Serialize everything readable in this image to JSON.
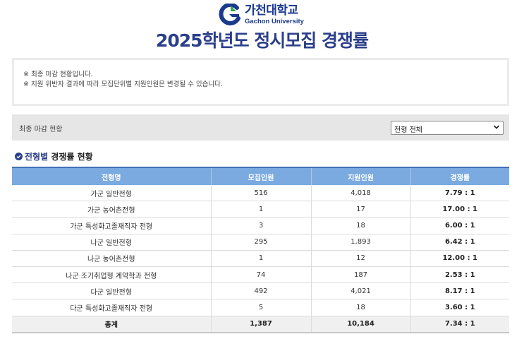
{
  "logo": {
    "korean": "가천대학교",
    "english": "Gachon University"
  },
  "page_title": "2025학년도 정시모집 경쟁률",
  "notice": [
    "※ 최종 마감 현황입니다.",
    "※ 지원 위반자 결과에 따라 모집단위별 지원인원은 변경될 수 있습니다."
  ],
  "filter": {
    "label": "최종 마감 현황",
    "selected": "전형 전체"
  },
  "section": {
    "highlight": "전형별",
    "rest": " 경쟁률 현황"
  },
  "table": {
    "headers": [
      "전형명",
      "모집인원",
      "지원인원",
      "경쟁률"
    ],
    "rows": [
      [
        "가군 일반전형",
        "516",
        "4,018",
        "7.79 : 1"
      ],
      [
        "가군 농어촌전형",
        "1",
        "17",
        "17.00 : 1"
      ],
      [
        "가군 특성화고졸재직자 전형",
        "3",
        "18",
        "6.00 : 1"
      ],
      [
        "나군 일반전형",
        "295",
        "1,893",
        "6.42 : 1"
      ],
      [
        "나군 농어촌전형",
        "1",
        "12",
        "12.00 : 1"
      ],
      [
        "나군 조기취업형 계약학과 전형",
        "74",
        "187",
        "2.53 : 1"
      ],
      [
        "다군 일반전형",
        "492",
        "4,021",
        "8.17 : 1"
      ],
      [
        "다군 특성화고졸재직자 전형",
        "5",
        "18",
        "3.60 : 1"
      ]
    ],
    "total": [
      "총계",
      "1,387",
      "10,184",
      "7.34 : 1"
    ]
  },
  "colors": {
    "brand": "#2b3f8c",
    "header_bg": "#7aaae0",
    "logo_green": "#3aa648"
  }
}
